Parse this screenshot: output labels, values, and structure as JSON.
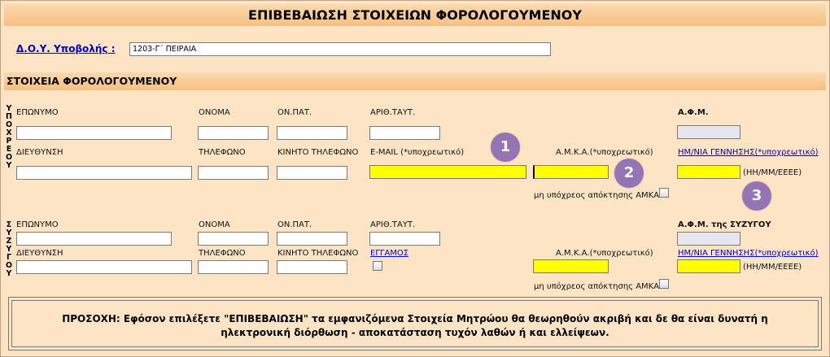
{
  "header": {
    "title": "ΕΠΙΒΕΒΑΙΩΣΗ ΣΤΟΙΧΕΙΩΝ ΦΟΡΟΛΟΓΟΥΜΕΝΟΥ"
  },
  "doy": {
    "label": "Δ.Ο.Υ. Υποβολής :",
    "value": "1203-Γ΄ ΠΕΙΡΑΙΑ"
  },
  "section": {
    "title": "ΣΤΟΙΧΕΙΑ ΦΟΡΟΛΟΓΟΥΜΕΝΟΥ"
  },
  "obligee": {
    "side_label": [
      "Υ",
      "Π",
      "Ο",
      "Χ",
      "Ρ",
      "Ε",
      "Ο",
      "Υ"
    ],
    "labels": {
      "surname": "ΕΠΩΝΥΜΟ",
      "name": "ΟΝΟΜΑ",
      "father": "ΟΝ.ΠΑΤ.",
      "id_number": "ΑΡΙΘ.ΤΑΥΤ.",
      "afm": "Α.Φ.Μ.",
      "address": "ΔΙΕΥΘΥΝΣΗ",
      "phone": "ΤΗΛΕΦΩΝΟ",
      "mobile": "ΚΙΝΗΤΟ ΤΗΛΕΦΩΝΟ",
      "email": "E-MAIL (*υποχρεωτικό)",
      "amka": "Α.Μ.Κ.Α.(*υποχρεωτικό)",
      "birthdate": "ΗΜ/ΝΙΑ ΓΕΝΝΗΣΗΣ(*υποχρεωτικό)",
      "date_format": "(ΗΗ/ΜΜ/ΕΕΕΕ)",
      "no_amka": "μη υπόχρεος απόκτησης ΑΜΚΑ"
    }
  },
  "spouse": {
    "side_label": [
      "Σ",
      "Υ",
      "Ζ",
      "Υ",
      "Γ",
      "Ο",
      "Υ"
    ],
    "labels": {
      "surname": "ΕΠΩΝΥΜΟ",
      "name": "ΟΝΟΜΑ",
      "father": "ΟΝ.ΠΑΤ.",
      "id_number": "ΑΡΙΘ.ΤΑΥΤ.",
      "afm": "Α.Φ.Μ. της ΣΥΖΥΓΟΥ",
      "address": "ΔΙΕΥΘΥΝΣΗ",
      "phone": "ΤΗΛΕΦΩΝΟ",
      "mobile": "ΚΙΝΗΤΟ ΤΗΛΕΦΩΝΟ",
      "married": "ΕΓΓΑΜΟΣ",
      "amka": "Α.Μ.Κ.Α.(*υποχρεωτικό)",
      "birthdate": "ΗΜ/ΝΙΑ ΓΕΝΝΗΣΗΣ(*υποχρεωτικό)",
      "date_format": "(ΗΗ/ΜΜ/ΕΕΕΕ)",
      "no_amka": "μη υπόχρεος απόκτησης ΑΜΚΑ"
    }
  },
  "markers": [
    "1",
    "2",
    "3"
  ],
  "warning": {
    "line1": "ΠΡΟΣΟΧΗ: Εφόσον επιλέξετε \"ΕΠΙΒΕΒΑΙΩΣΗ\" τα εμφανιζόμενα Στοιχεία Μητρώου θα θεωρηθούν ακριβή και δε θα είναι δυνατή η",
    "line2": "ηλεκτρονική διόρθωση - αποκατάσταση τυχόν λαθών ή και ελλείψεων."
  },
  "colors": {
    "required_field": "#ffff00",
    "band": "#f7bf82",
    "background": "#fde4c4",
    "marker": "#9474b4",
    "link": "#0000cc"
  }
}
